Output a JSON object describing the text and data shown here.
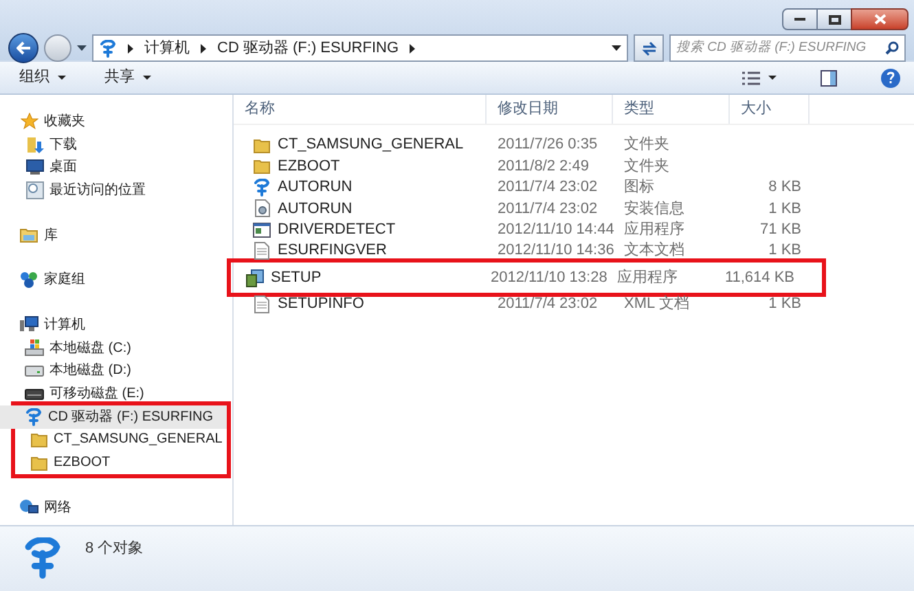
{
  "address": {
    "crumbs": [
      "计算机",
      "CD 驱动器 (F:) ESURFING"
    ]
  },
  "search": {
    "placeholder": "搜索 CD 驱动器 (F:) ESURFING"
  },
  "toolbar": [
    "组织",
    "共享"
  ],
  "sidebar": [
    {
      "label": "收藏夹",
      "kind": "favorites",
      "selected": false,
      "children": [
        {
          "label": "下载",
          "kind": "download",
          "selected": false
        },
        {
          "label": "桌面",
          "kind": "desktop",
          "selected": false
        },
        {
          "label": "最近访问的位置",
          "kind": "recent",
          "selected": false
        }
      ]
    },
    {
      "label": "库",
      "kind": "library",
      "selected": false
    },
    {
      "label": "家庭组",
      "kind": "homegroup",
      "selected": false
    },
    {
      "label": "计算机",
      "kind": "computer",
      "selected": false,
      "children": [
        {
          "label": "本地磁盘 (C:)",
          "kind": "system-disk",
          "selected": false
        },
        {
          "label": "本地磁盘 (D:)",
          "kind": "disk",
          "selected": false
        },
        {
          "label": "可移动磁盘 (E:)",
          "kind": "removable",
          "selected": false
        },
        {
          "label": "CD 驱动器 (F:) ESURFING",
          "kind": "cd",
          "selected": true,
          "boxed": true,
          "children": [
            {
              "label": "CT_SAMSUNG_GENERAL",
              "kind": "folder",
              "selected": false
            },
            {
              "label": "EZBOOT",
              "kind": "folder",
              "selected": false
            }
          ]
        }
      ]
    },
    {
      "label": "网络",
      "kind": "network",
      "selected": false
    }
  ],
  "table": {
    "columns": [
      "名称",
      "修改日期",
      "类型",
      "大小"
    ],
    "rows": [
      {
        "name": "CT_SAMSUNG_GENERAL",
        "date": "2011/7/26 0:35",
        "type": "文件夹",
        "size": "",
        "kind": "folder",
        "boxed": false
      },
      {
        "name": "EZBOOT",
        "date": "2011/8/2 2:49",
        "type": "文件夹",
        "size": "",
        "kind": "folder",
        "boxed": false
      },
      {
        "name": "AUTORUN",
        "date": "2011/7/4 23:02",
        "type": "图标",
        "size": "8 KB",
        "kind": "icon-file",
        "boxed": false
      },
      {
        "name": "AUTORUN",
        "date": "2011/7/4 23:02",
        "type": "安装信息",
        "size": "1 KB",
        "kind": "settings-file",
        "boxed": false
      },
      {
        "name": "DRIVERDETECT",
        "date": "2012/11/10 14:44",
        "type": "应用程序",
        "size": "71 KB",
        "kind": "app",
        "boxed": false
      },
      {
        "name": "ESURFINGVER",
        "date": "2012/11/10 14:36",
        "type": "文本文档",
        "size": "1 KB",
        "kind": "text",
        "boxed": false
      },
      {
        "name": "SETUP",
        "date": "2012/11/10 13:28",
        "type": "应用程序",
        "size": "11,614 KB",
        "kind": "installer",
        "boxed": true
      },
      {
        "name": "SETUPINFO",
        "date": "2011/7/4 23:02",
        "type": "XML 文档",
        "size": "1 KB",
        "kind": "text",
        "boxed": false
      }
    ]
  },
  "status_bar": {
    "text": "8 个对象"
  }
}
